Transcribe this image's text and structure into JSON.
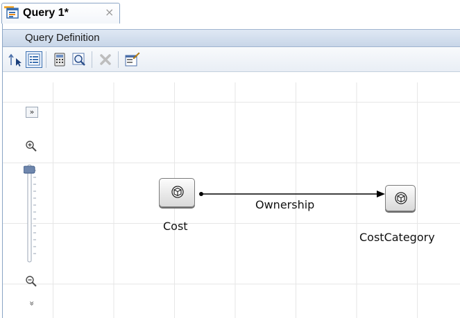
{
  "tab": {
    "title": "Query  1*",
    "close": "×",
    "icon": "query-icon"
  },
  "panel": {
    "title": "Query Definition"
  },
  "toolbar": {
    "buttons": [
      {
        "name": "move-up-icon"
      },
      {
        "name": "list-view-icon"
      },
      {
        "name": "calculator-icon"
      },
      {
        "name": "zoom-find-icon"
      },
      {
        "name": "delete-icon"
      },
      {
        "name": "properties-icon"
      }
    ]
  },
  "zoom": {
    "expand_label": "»",
    "collapse_label": "»",
    "level": 1.0
  },
  "graph": {
    "nodes": [
      {
        "id": "cost",
        "label": "Cost"
      },
      {
        "id": "costcategory",
        "label": "CostCategory"
      }
    ],
    "edges": [
      {
        "from": "cost",
        "to": "costcategory",
        "label": "Ownership"
      }
    ]
  },
  "colors": {
    "accent": "#f5a623",
    "header": "#c8d6e8",
    "grid": "#e6e6e6"
  }
}
